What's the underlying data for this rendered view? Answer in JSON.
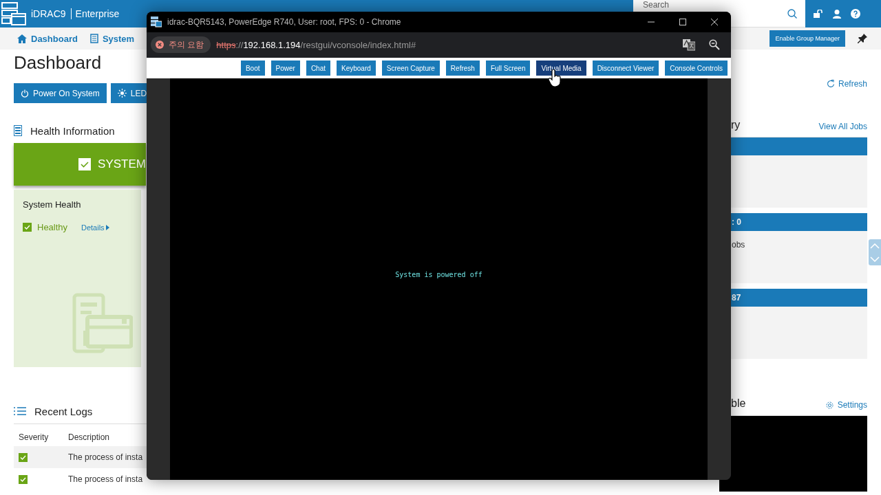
{
  "app": {
    "name": "iDRAC9",
    "edition": "Enterprise"
  },
  "search": {
    "placeholder": "Search"
  },
  "nav": [
    {
      "label": "Dashboard",
      "kind": "home"
    },
    {
      "label": "System",
      "kind": "system"
    }
  ],
  "group_manager": "Enable Group Manager",
  "page_title": "Dashboard",
  "actions": [
    {
      "label": "Power On System",
      "kind": "power"
    },
    {
      "label": "LED",
      "kind": "led"
    }
  ],
  "health": {
    "title": "Health Information",
    "banner": "SYSTEM",
    "panel_title": "System Health",
    "status": "Healthy",
    "details": "Details"
  },
  "refresh": "Refresh",
  "jobs": {
    "title_fragment": "ry",
    "view_all": "View All Jobs",
    "panels": [
      {
        "header": ": 0",
        "text": "obs"
      },
      {
        "header": "87"
      }
    ]
  },
  "logs": {
    "title": "Recent Logs",
    "columns": [
      "Severity",
      "Description"
    ],
    "rows": [
      {
        "kind": "ok",
        "description": "The process of insta"
      },
      {
        "kind": "ok",
        "description": "The process of insta"
      }
    ]
  },
  "console_panel": {
    "title_fragment": "ble",
    "settings": "Settings"
  },
  "window": {
    "title": "idrac-BQR5143, PowerEdge R740, User: root, FPS: 0 - Chrome",
    "security": "주의 요함",
    "url": {
      "scheme": "https",
      "separator": "://",
      "host": "192.168.1.194",
      "path": "/restgui/vconsole/index.html#"
    },
    "toolbar": [
      {
        "label": "Boot",
        "selected": false
      },
      {
        "label": "Power",
        "selected": false
      },
      {
        "label": "Chat",
        "selected": false
      },
      {
        "label": "Keyboard",
        "selected": false
      },
      {
        "label": "Screen Capture",
        "selected": false
      },
      {
        "label": "Refresh",
        "selected": false
      },
      {
        "label": "Full Screen",
        "selected": false
      },
      {
        "label": "Virtual Media",
        "selected": true
      },
      {
        "label": "Disconnect Viewer",
        "selected": false
      },
      {
        "label": "Console Controls",
        "selected": false
      }
    ],
    "screen_message": "System is powered off"
  }
}
